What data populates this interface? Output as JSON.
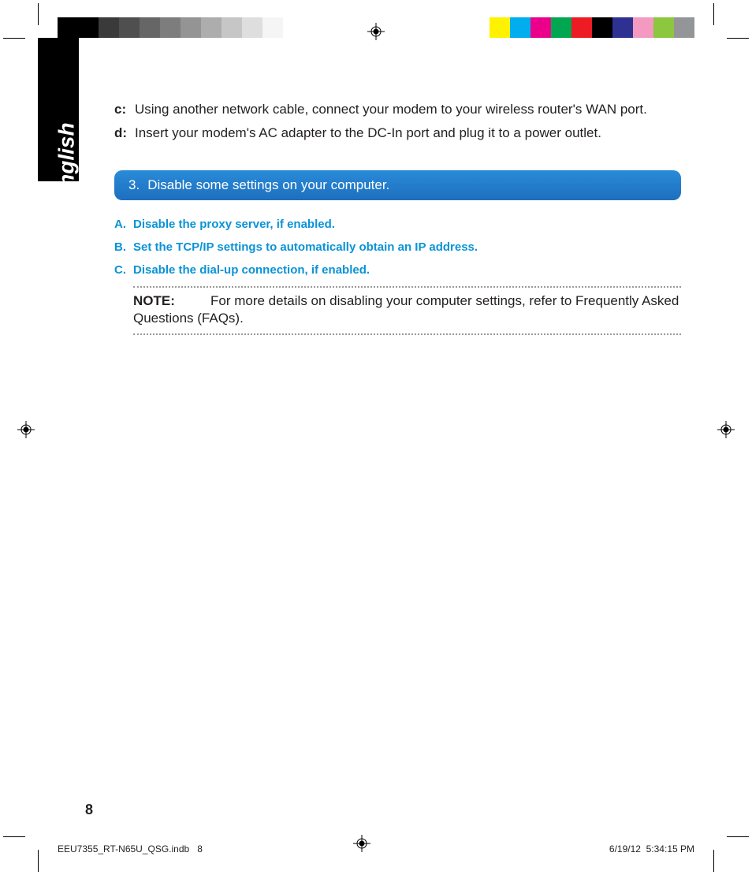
{
  "language_tab": "English",
  "steps": [
    {
      "letter": "c:",
      "text": "Using another network cable, connect your modem to your wireless router's WAN port."
    },
    {
      "letter": "d:",
      "text": "Insert your modem's AC adapter to the DC-In port and plug it to a power outlet."
    }
  ],
  "section": {
    "number": "3.",
    "title": "Disable some settings on your computer."
  },
  "blue_items": [
    {
      "letter": "A.",
      "text": "Disable the proxy server, if enabled."
    },
    {
      "letter": "B.",
      "text": "Set the TCP/IP settings to automatically obtain an IP address."
    },
    {
      "letter": "C.",
      "text": "Disable the dial-up connection, if enabled."
    }
  ],
  "note": {
    "label": "NOTE:",
    "text": "For more details on disabling your computer settings, refer to Frequently Asked Questions (FAQs)."
  },
  "page_number": "8",
  "footer": {
    "file": "EEU7355_RT-N65U_QSG.indb",
    "page": "8",
    "date": "6/19/12",
    "time": "5:34:15 PM"
  },
  "colorbars": {
    "left": [
      "#000000",
      "#000000",
      "#3a3a3a",
      "#4f4f4f",
      "#666666",
      "#7d7d7d",
      "#949494",
      "#adadad",
      "#c6c6c6",
      "#dedede",
      "#f5f5f5",
      "#ffffff"
    ],
    "right": [
      "#ffffff",
      "#fff200",
      "#00adee",
      "#ec008b",
      "#00a650",
      "#ed1b24",
      "#000000",
      "#2e3092",
      "#f49ac1",
      "#8dc63f",
      "#939598"
    ]
  }
}
